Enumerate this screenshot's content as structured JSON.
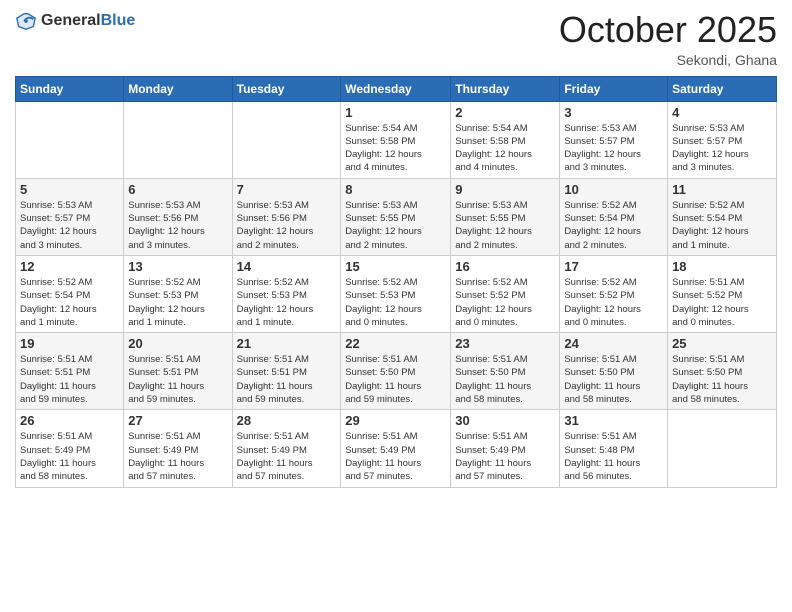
{
  "header": {
    "logo_general": "General",
    "logo_blue": "Blue",
    "month_year": "October 2025",
    "location": "Sekondi, Ghana"
  },
  "days_of_week": [
    "Sunday",
    "Monday",
    "Tuesday",
    "Wednesday",
    "Thursday",
    "Friday",
    "Saturday"
  ],
  "weeks": [
    [
      {
        "day": "",
        "info": ""
      },
      {
        "day": "",
        "info": ""
      },
      {
        "day": "",
        "info": ""
      },
      {
        "day": "1",
        "info": "Sunrise: 5:54 AM\nSunset: 5:58 PM\nDaylight: 12 hours\nand 4 minutes."
      },
      {
        "day": "2",
        "info": "Sunrise: 5:54 AM\nSunset: 5:58 PM\nDaylight: 12 hours\nand 4 minutes."
      },
      {
        "day": "3",
        "info": "Sunrise: 5:53 AM\nSunset: 5:57 PM\nDaylight: 12 hours\nand 3 minutes."
      },
      {
        "day": "4",
        "info": "Sunrise: 5:53 AM\nSunset: 5:57 PM\nDaylight: 12 hours\nand 3 minutes."
      }
    ],
    [
      {
        "day": "5",
        "info": "Sunrise: 5:53 AM\nSunset: 5:57 PM\nDaylight: 12 hours\nand 3 minutes."
      },
      {
        "day": "6",
        "info": "Sunrise: 5:53 AM\nSunset: 5:56 PM\nDaylight: 12 hours\nand 3 minutes."
      },
      {
        "day": "7",
        "info": "Sunrise: 5:53 AM\nSunset: 5:56 PM\nDaylight: 12 hours\nand 2 minutes."
      },
      {
        "day": "8",
        "info": "Sunrise: 5:53 AM\nSunset: 5:55 PM\nDaylight: 12 hours\nand 2 minutes."
      },
      {
        "day": "9",
        "info": "Sunrise: 5:53 AM\nSunset: 5:55 PM\nDaylight: 12 hours\nand 2 minutes."
      },
      {
        "day": "10",
        "info": "Sunrise: 5:52 AM\nSunset: 5:54 PM\nDaylight: 12 hours\nand 2 minutes."
      },
      {
        "day": "11",
        "info": "Sunrise: 5:52 AM\nSunset: 5:54 PM\nDaylight: 12 hours\nand 1 minute."
      }
    ],
    [
      {
        "day": "12",
        "info": "Sunrise: 5:52 AM\nSunset: 5:54 PM\nDaylight: 12 hours\nand 1 minute."
      },
      {
        "day": "13",
        "info": "Sunrise: 5:52 AM\nSunset: 5:53 PM\nDaylight: 12 hours\nand 1 minute."
      },
      {
        "day": "14",
        "info": "Sunrise: 5:52 AM\nSunset: 5:53 PM\nDaylight: 12 hours\nand 1 minute."
      },
      {
        "day": "15",
        "info": "Sunrise: 5:52 AM\nSunset: 5:53 PM\nDaylight: 12 hours\nand 0 minutes."
      },
      {
        "day": "16",
        "info": "Sunrise: 5:52 AM\nSunset: 5:52 PM\nDaylight: 12 hours\nand 0 minutes."
      },
      {
        "day": "17",
        "info": "Sunrise: 5:52 AM\nSunset: 5:52 PM\nDaylight: 12 hours\nand 0 minutes."
      },
      {
        "day": "18",
        "info": "Sunrise: 5:51 AM\nSunset: 5:52 PM\nDaylight: 12 hours\nand 0 minutes."
      }
    ],
    [
      {
        "day": "19",
        "info": "Sunrise: 5:51 AM\nSunset: 5:51 PM\nDaylight: 11 hours\nand 59 minutes."
      },
      {
        "day": "20",
        "info": "Sunrise: 5:51 AM\nSunset: 5:51 PM\nDaylight: 11 hours\nand 59 minutes."
      },
      {
        "day": "21",
        "info": "Sunrise: 5:51 AM\nSunset: 5:51 PM\nDaylight: 11 hours\nand 59 minutes."
      },
      {
        "day": "22",
        "info": "Sunrise: 5:51 AM\nSunset: 5:50 PM\nDaylight: 11 hours\nand 59 minutes."
      },
      {
        "day": "23",
        "info": "Sunrise: 5:51 AM\nSunset: 5:50 PM\nDaylight: 11 hours\nand 58 minutes."
      },
      {
        "day": "24",
        "info": "Sunrise: 5:51 AM\nSunset: 5:50 PM\nDaylight: 11 hours\nand 58 minutes."
      },
      {
        "day": "25",
        "info": "Sunrise: 5:51 AM\nSunset: 5:50 PM\nDaylight: 11 hours\nand 58 minutes."
      }
    ],
    [
      {
        "day": "26",
        "info": "Sunrise: 5:51 AM\nSunset: 5:49 PM\nDaylight: 11 hours\nand 58 minutes."
      },
      {
        "day": "27",
        "info": "Sunrise: 5:51 AM\nSunset: 5:49 PM\nDaylight: 11 hours\nand 57 minutes."
      },
      {
        "day": "28",
        "info": "Sunrise: 5:51 AM\nSunset: 5:49 PM\nDaylight: 11 hours\nand 57 minutes."
      },
      {
        "day": "29",
        "info": "Sunrise: 5:51 AM\nSunset: 5:49 PM\nDaylight: 11 hours\nand 57 minutes."
      },
      {
        "day": "30",
        "info": "Sunrise: 5:51 AM\nSunset: 5:49 PM\nDaylight: 11 hours\nand 57 minutes."
      },
      {
        "day": "31",
        "info": "Sunrise: 5:51 AM\nSunset: 5:48 PM\nDaylight: 11 hours\nand 56 minutes."
      },
      {
        "day": "",
        "info": ""
      }
    ]
  ]
}
